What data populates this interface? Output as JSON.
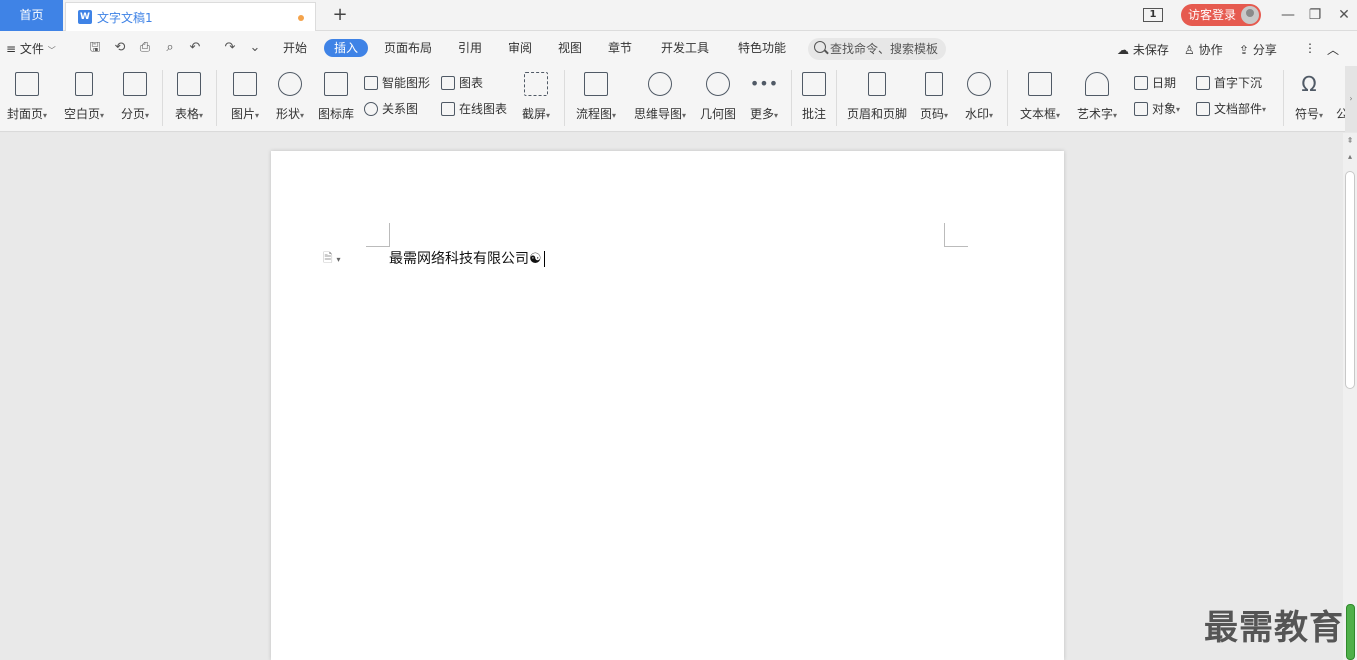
{
  "titlebar": {
    "home_tab": "首页",
    "doc_tab": "文字文稿1",
    "doc_badge_letter": "W",
    "add_tab": "+",
    "window_badge": "1",
    "login": "访客登录",
    "minimize": "—",
    "restore": "❐",
    "close": "✕"
  },
  "menubar": {
    "file": "≡ 文件",
    "tabs": [
      "开始",
      "插入",
      "页面布局",
      "引用",
      "审阅",
      "视图",
      "章节",
      "开发工具",
      "特色功能"
    ],
    "active_tab": "插入",
    "search_placeholder": "查找命令、搜索模板",
    "unsaved": "未保存",
    "collab": "协作",
    "share": "分享",
    "more": "⋮",
    "collapse": "︿"
  },
  "ribbon": {
    "cover": "封面页",
    "blank": "空白页",
    "pagebreak": "分页",
    "table": "表格",
    "picture": "图片",
    "shape": "形状",
    "iconlib": "图标库",
    "smartart": "智能图形",
    "relation": "关系图",
    "chart": "图表",
    "onlinechart": "在线图表",
    "screenshot": "截屏",
    "flowchart": "流程图",
    "mindmap": "思维导图",
    "geometry": "几何图",
    "more": "更多",
    "comment": "批注",
    "headerfooter": "页眉和页脚",
    "pagenum": "页码",
    "watermark": "水印",
    "textbox": "文本框",
    "wordart": "艺术字",
    "date": "日期",
    "object": "对象",
    "dropcap": "首字下沉",
    "docpart": "文档部件",
    "symbol": "符号",
    "formula_partial": "公"
  },
  "document": {
    "text": "最需网络科技有限公司☯"
  },
  "watermark": "最需教育"
}
